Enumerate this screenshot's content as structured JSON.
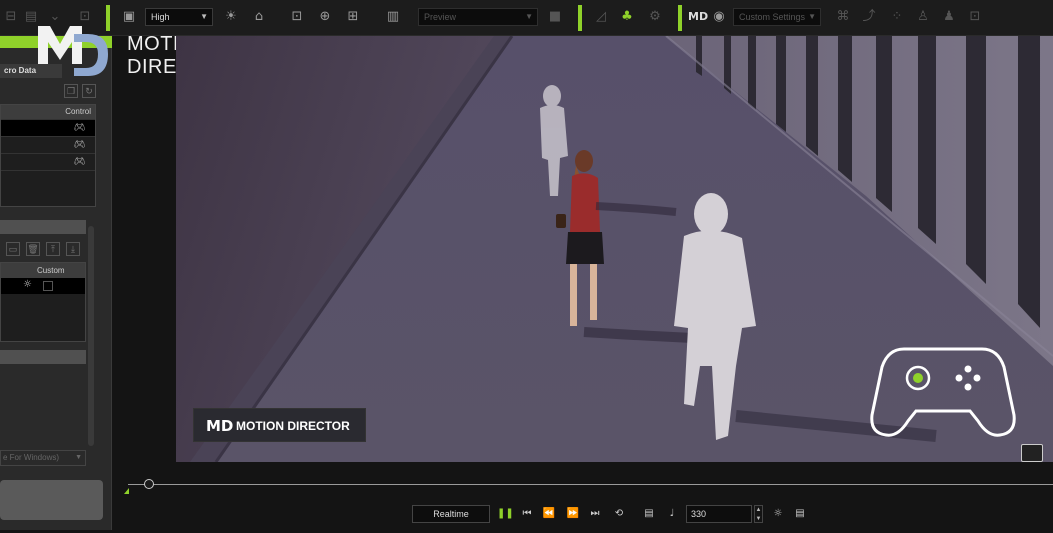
{
  "toolbar": {
    "quality_select": "High",
    "preview_select": "Preview",
    "custom_settings_select": "Custom Settings"
  },
  "left_panel": {
    "micro_data_label": "cro Data",
    "table1_header": "Control",
    "table2_header": "Custom",
    "combo_text": "e For Windows)"
  },
  "overlay": {
    "title_line1": "MOTION",
    "title_line2": "DIRECTOR",
    "badge_mark": "MD",
    "badge_text": "MOTION DIRECTOR"
  },
  "playback": {
    "realtime_label": "Realtime",
    "frame_value": "330"
  },
  "colors": {
    "accent": "#8fd12a",
    "viewport_bg": "#4c4658"
  }
}
